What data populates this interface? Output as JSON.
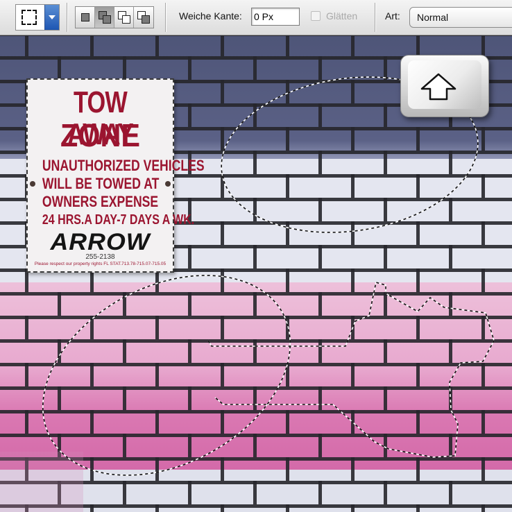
{
  "options_bar": {
    "tool_icon": "rectangular-marquee-icon",
    "selection_modes": [
      "new-selection-icon",
      "add-to-selection-icon",
      "subtract-from-selection-icon",
      "intersect-selection-icon"
    ],
    "feather_label": "Weiche Kante:",
    "feather_value": "0 Px",
    "antialias_label": "Glätten",
    "style_label": "Art:",
    "style_value": "Normal"
  },
  "sign": {
    "line1": "TOW AWAY",
    "line2": "ZONE",
    "line3": "UNAUTHORIZED VEHICLES",
    "line4": "WILL BE TOWED AT",
    "line5": "OWNERS EXPENSE",
    "line6": "24 HRS.A DAY-7 DAYS A WK.",
    "brand": "ARROW",
    "phone": "255-2138",
    "fine_print": "Please respect our property rights FL STAT.713.78-715.07-715.05"
  },
  "overlay": {
    "key_icon": "shift-arrow-icon"
  },
  "colors": {
    "brick_dark": "#565c80",
    "brick_white": "#e6e8f2",
    "brick_pink_light": "#e9b2d3",
    "brick_pink": "#d971ad",
    "mortar": "#2a2a2e",
    "sign_red": "#9b1530",
    "accent_blue": "#2d66c4"
  }
}
